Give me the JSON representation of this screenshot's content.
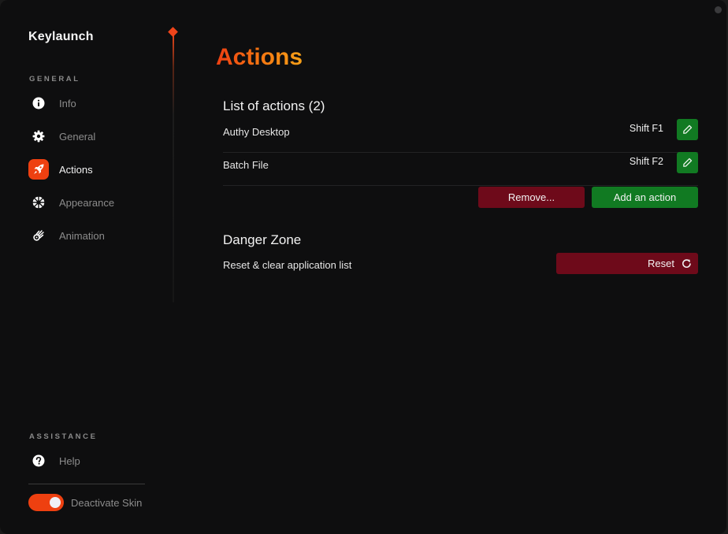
{
  "app": {
    "title": "Keylaunch"
  },
  "sidebar": {
    "general_label": "GENERAL",
    "items": [
      {
        "label": "Info",
        "icon": "info-icon",
        "active": false
      },
      {
        "label": "General",
        "icon": "gear-icon",
        "active": false
      },
      {
        "label": "Actions",
        "icon": "rocket-icon",
        "active": true
      },
      {
        "label": "Appearance",
        "icon": "aperture-icon",
        "active": false
      },
      {
        "label": "Animation",
        "icon": "comet-icon",
        "active": false
      }
    ],
    "assistance_label": "ASSISTANCE",
    "help": {
      "label": "Help",
      "icon": "question-icon"
    },
    "skin_toggle": {
      "label": "Deactivate Skin",
      "on": true
    }
  },
  "main": {
    "title": "Actions",
    "list_title": "List of actions (2)",
    "actions": [
      {
        "name": "Authy Desktop",
        "shortcut": "Shift F1"
      },
      {
        "name": "Batch File",
        "shortcut": "Shift F2"
      }
    ],
    "remove_label": "Remove...",
    "add_label": "Add an action",
    "danger_title": "Danger Zone",
    "reset_description": "Reset & clear application list",
    "reset_label": "Reset"
  },
  "colors": {
    "accent": "#ee4010",
    "danger": "#6e0a1a",
    "success": "#117a22",
    "background": "#0e0e0f"
  }
}
